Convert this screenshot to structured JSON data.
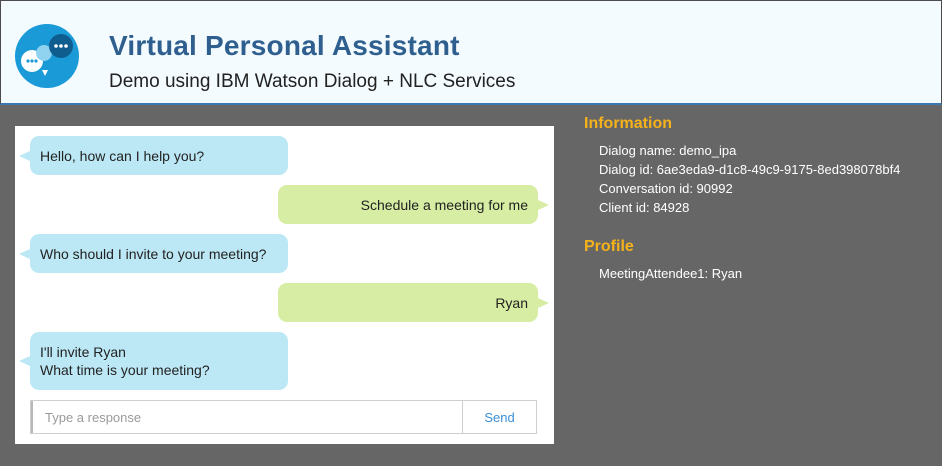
{
  "header": {
    "title": "Virtual Personal Assistant",
    "subtitle": "Demo using IBM Watson Dialog + NLC Services",
    "logo_icon": "chat-bubbles-icon"
  },
  "chat": {
    "messages": [
      {
        "from": "watson",
        "lines": [
          "Hello, how can I help you?"
        ]
      },
      {
        "from": "user",
        "lines": [
          "Schedule a meeting for me"
        ]
      },
      {
        "from": "watson",
        "lines": [
          "Who should I invite to your meeting?"
        ]
      },
      {
        "from": "user",
        "lines": [
          "Ryan"
        ]
      },
      {
        "from": "watson",
        "lines": [
          "I'll invite Ryan",
          "What time is your meeting?"
        ]
      }
    ],
    "input": {
      "value": "",
      "placeholder": "Type a response"
    },
    "send_label": "Send"
  },
  "information": {
    "title": "Information",
    "lines": [
      "Dialog name: demo_ipa",
      "Dialog id: 6ae3eda9-d1c8-49c9-9175-8ed398078bf4",
      "Conversation id: 90992",
      "Client id: 84928"
    ]
  },
  "profile": {
    "title": "Profile",
    "lines": [
      "MeetingAttendee1: Ryan"
    ]
  },
  "colors": {
    "watson_bubble": "#bce8f5",
    "user_bubble": "#d6eda3",
    "section_title": "#f5b21b",
    "title": "#2f5f8f",
    "background": "#666666"
  }
}
